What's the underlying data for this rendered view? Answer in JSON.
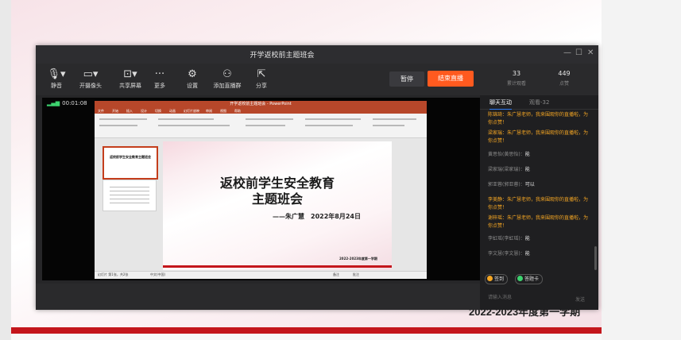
{
  "background": {
    "footer_text": "2022-2023年度第一学期",
    "colors": {
      "accent_red": "#c4161c"
    }
  },
  "window": {
    "title": "开学返校前主题班会",
    "minimize": "—",
    "maximize": "☐",
    "close": "✕"
  },
  "toolbar": {
    "items": [
      {
        "label": "静音",
        "icon": "🎙▾"
      },
      {
        "label": "开摄像头",
        "icon": "▭▾"
      },
      {
        "label": "共享屏幕",
        "icon": "⊡▾"
      },
      {
        "label": "更多",
        "icon": "···"
      },
      {
        "label": "设置",
        "icon": "⚙"
      },
      {
        "label": "添加直播群",
        "icon": "⚇"
      },
      {
        "label": "分享",
        "icon": "⇱"
      }
    ],
    "pause_label": "暂停",
    "end_label": "结束直播",
    "stats": [
      {
        "value": "33",
        "label": "累计观看"
      },
      {
        "value": "449",
        "label": "点赞"
      }
    ]
  },
  "video": {
    "elapsed": "00:01:08",
    "signal_icon": "▂▄▆"
  },
  "ppt": {
    "window_title": "开学返校前主题班会 - PowerPoint",
    "tabs": [
      "文件",
      "开始",
      "插入",
      "设计",
      "切换",
      "动画",
      "幻灯片放映",
      "审阅",
      "视图",
      "帮助"
    ],
    "thumb1_title": "返校前学生安全教育主题班会",
    "slide": {
      "title_line1": "返校前学生安全教育",
      "title_line2": "主题班会",
      "author_line": "——朱广慧　2022年8月24日",
      "footer": "2022-2023年度第一学期"
    },
    "status": [
      "幻灯片 第1张，共2张",
      "中文(中国)",
      "备注",
      "批注"
    ]
  },
  "chat": {
    "tabs": [
      "聊天互动",
      "观看-32"
    ],
    "messages": [
      {
        "type": "gift",
        "text": "陈锦琦：朱广慧老师，我来围观你的直播啦，为你点赞！"
      },
      {
        "type": "gift",
        "text": "梁家瑞：朱广慧老师，我来围观你的直播啦，为你点赞！"
      },
      {
        "type": "text",
        "name": "黄思怡(黄思怡)：",
        "body": "能"
      },
      {
        "type": "text",
        "name": "梁家瑞(梁家瑞)：",
        "body": "能"
      },
      {
        "type": "text",
        "name": "郭亚蓉(郭亚蓉)：",
        "body": "可以"
      },
      {
        "type": "gift",
        "text": "李美静：朱广慧老师，我来围观你的直播啦，为你点赞！"
      },
      {
        "type": "gift",
        "text": "谢梓瑶：朱广慧老师，我来围观你的直播啦，为你点赞！"
      },
      {
        "type": "text",
        "name": "李虹瑶(李虹瑶)：",
        "body": "能"
      },
      {
        "type": "text",
        "name": "李文慧(李文慧)：",
        "body": "能"
      }
    ],
    "signin_label": "签到",
    "answer_label": "答题卡",
    "input_placeholder": "请输入消息",
    "send_label": "发送",
    "colors": {
      "gift": "#f5a623",
      "signin_dot": "#f5a623",
      "answer_dot": "#3dd36f",
      "end_button": "#ff5a1f"
    }
  }
}
